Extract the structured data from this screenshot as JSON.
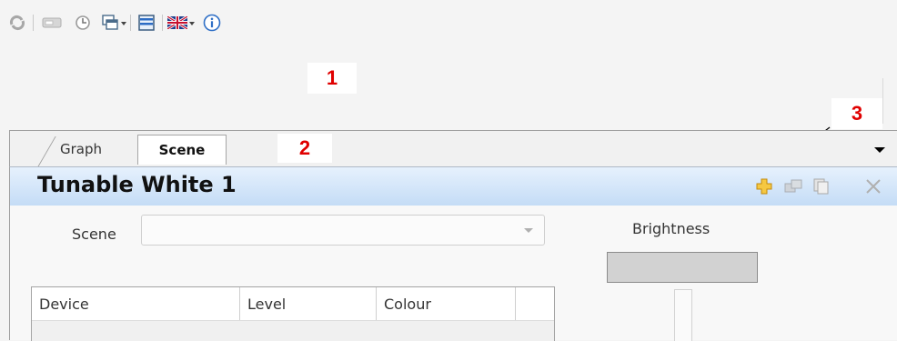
{
  "toolbar": {
    "icons": [
      "refresh-icon",
      "device-icon",
      "clock-icon",
      "window-icon",
      "list-view-icon",
      "uk-flag-icon",
      "info-icon"
    ]
  },
  "callouts": {
    "c1": "1",
    "c2": "2",
    "c3": "3"
  },
  "tabs": {
    "graph": "Graph",
    "scene": "Scene"
  },
  "panel": {
    "title": "Tunable White 1"
  },
  "form": {
    "scene_label": "Scene",
    "scene_value": "",
    "brightness_label": "Brightness"
  },
  "table": {
    "columns": [
      "Device",
      "Level",
      "Colour",
      ""
    ]
  },
  "colors": {
    "header_gradient_top": "#e6f1fd",
    "header_gradient_bottom": "#c4dcf6",
    "callout_red": "#e00000",
    "add_icon_yellow": "#f2b21a"
  }
}
